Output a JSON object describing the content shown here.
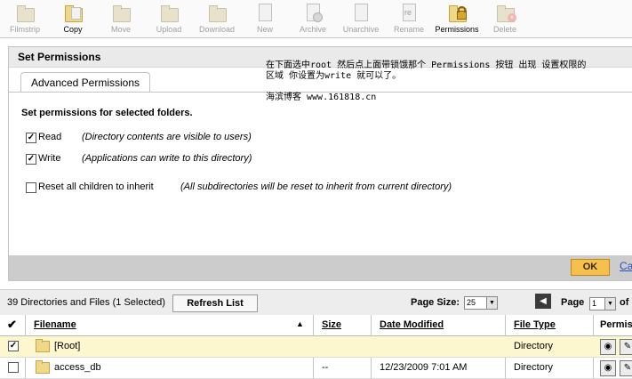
{
  "toolbar": {
    "buttons": [
      {
        "label": "Filmstrip",
        "icon": "filmstrip-icon",
        "enabled": false
      },
      {
        "label": "Copy",
        "icon": "copy-icon",
        "enabled": true
      },
      {
        "label": "Move",
        "icon": "move-icon",
        "enabled": false
      },
      {
        "label": "Upload",
        "icon": "upload-icon",
        "enabled": false
      },
      {
        "label": "Download",
        "icon": "download-icon",
        "enabled": false
      },
      {
        "label": "New",
        "icon": "new-icon",
        "enabled": false
      },
      {
        "label": "Archive",
        "icon": "archive-icon",
        "enabled": false
      },
      {
        "label": "Unarchive",
        "icon": "unarchive-icon",
        "enabled": false
      },
      {
        "label": "Rename",
        "icon": "rename-icon",
        "enabled": false
      },
      {
        "label": "Permissions",
        "icon": "permissions-lock-icon",
        "enabled": true
      },
      {
        "label": "Delete",
        "icon": "delete-icon",
        "enabled": false
      }
    ],
    "rename_icon_text": "re"
  },
  "panel": {
    "title": "Set Permissions",
    "tab": "Advanced Permissions",
    "intro": "Set permissions for selected folders.",
    "options": [
      {
        "label": "Read",
        "checked": true,
        "desc": "(Directory contents are visible to users)"
      },
      {
        "label": "Write",
        "checked": true,
        "desc": "(Applications can write to this directory)"
      },
      {
        "label": "Reset all children to inherit",
        "checked": false,
        "desc": "(All subdirectories will be reset to inherit from current directory)"
      }
    ],
    "note_line1": "在下面选中root 然后点上面带锁饿那个 Permissions 按钮 出现 设置权限的",
    "note_line2": "区域 你设置为write 就可以了。",
    "note_line3": "海滨博客 www.161818.cn",
    "ok": "OK",
    "cancel": "Ca"
  },
  "list": {
    "count": "39 Directories and Files (1 Selected)",
    "refresh": "Refresh List",
    "page_size_label": "Page Size:",
    "page_size": "25",
    "page_label": "Page",
    "page": "1",
    "of_label": "of",
    "columns": [
      "Filename",
      "Size",
      "Date Modified",
      "File Type",
      "Permis"
    ],
    "rows": [
      {
        "checked": true,
        "name": "[Root]",
        "size": "",
        "date": "",
        "type": "Directory"
      },
      {
        "checked": false,
        "name": "access_db",
        "size": "--",
        "date": "12/23/2009 7:01 AM",
        "type": "Directory"
      }
    ]
  },
  "colors": {
    "ok": "#f6c04f",
    "selected_row": "#fcf7cf",
    "link": "#2a4fb8"
  }
}
